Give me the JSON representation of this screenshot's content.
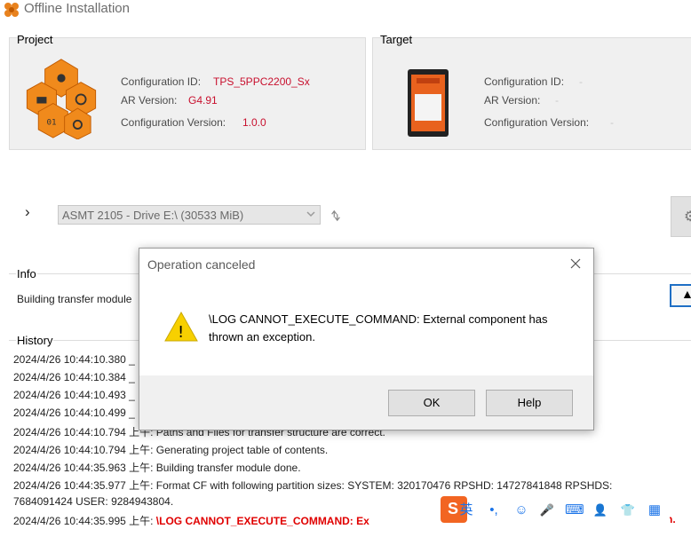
{
  "window": {
    "title": "Offline Installation"
  },
  "project": {
    "title": "Project",
    "config_id_label": "Configuration ID:",
    "config_id_value": "TPS_5PPC2200_Sx",
    "ar_version_label": "AR Version:",
    "ar_version_value": "G4.91",
    "config_version_label": "Configuration Version:",
    "config_version_value": "1.0.0"
  },
  "target": {
    "title": "Target",
    "config_id_label": "Configuration ID:",
    "ar_version_label": "AR Version:",
    "config_version_label": "Configuration Version:",
    "config_id_value": "-",
    "ar_version_value": "-",
    "config_version_value": "-"
  },
  "drive_selector": {
    "expand_glyph": "›",
    "selected": "ASMT 2105 - Drive E:\\ (30533 MiB)"
  },
  "info": {
    "title": "Info",
    "text": "Building transfer module"
  },
  "history": {
    "title": "History",
    "lines": [
      "2024/4/26 10:44:10.380 _",
      "2024/4/26 10:44:10.384 _",
      "2024/4/26 10:44:10.493 _",
      "2024/4/26 10:44:10.499 _",
      "2024/4/26 10:44:10.794 上午: Paths and Files for transfer structure are correct.",
      "2024/4/26 10:44:10.794 上午: Generating project table of contents.",
      "2024/4/26 10:44:35.963 上午: Building transfer module done.",
      "2024/4/26 10:44:35.977 上午: Format CF with following partition sizes: SYSTEM: 320170476 RPSHD: 14727841848 RPSHDS:",
      "7684091424 USER: 9284943804."
    ],
    "last_prefix": "2024/4/26 10:44:35.995 上午: ",
    "last_error": "\\LOG CANNOT_EXECUTE_COMMAND: Ex",
    "last_error_tail": "ption."
  },
  "dialog": {
    "title": "Operation canceled",
    "message": "\\LOG CANNOT_EXECUTE_COMMAND: External component has thrown an exception.",
    "ok_label": "OK",
    "help_label": "Help",
    "warning_glyph": "!"
  },
  "ime_toolbar": {
    "logo": "S",
    "lang": "英",
    "punct": "•,",
    "emoji": "☺",
    "voice": "🎤",
    "keyboard": "⌨",
    "user": "👤",
    "skin": "👕",
    "tools": "▦"
  },
  "colors": {
    "accent": "#c8102e",
    "error": "#e00000",
    "panel": "#f0f0f0"
  }
}
